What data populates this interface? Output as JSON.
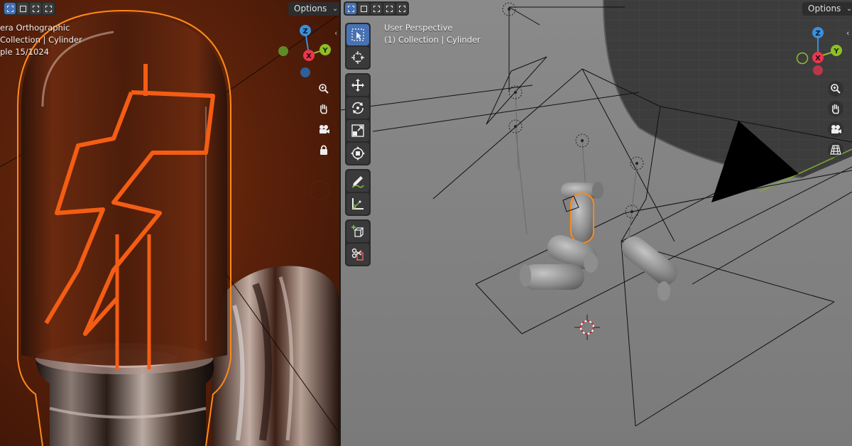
{
  "left_viewport": {
    "options_label": "Options",
    "overlay_lines": [
      "era Orthographic",
      "Collection | Cylinder",
      "ple 15/1024"
    ]
  },
  "right_viewport": {
    "options_label": "Options",
    "overlay_lines": [
      "User Perspective",
      "(1) Collection | Cylinder"
    ]
  },
  "gizmo": {
    "z": "Z",
    "x": "X",
    "y": "Y"
  },
  "nav_icons": [
    "zoom-icon",
    "hand-pan-icon",
    "camera-icon",
    "lock-icon",
    "grid-icon"
  ],
  "toolbar_tools": [
    "select-box",
    "cursor",
    "move",
    "rotate",
    "scale",
    "transform",
    "annotate",
    "measure",
    "add-cube",
    "shear"
  ],
  "colors": {
    "accent_blue": "#4772b3",
    "selection_orange": "#ff8a1a",
    "axis_x": "#e8384f",
    "axis_y": "#8fbf26",
    "axis_z": "#3b8fdb",
    "filament": "#f45d14"
  }
}
